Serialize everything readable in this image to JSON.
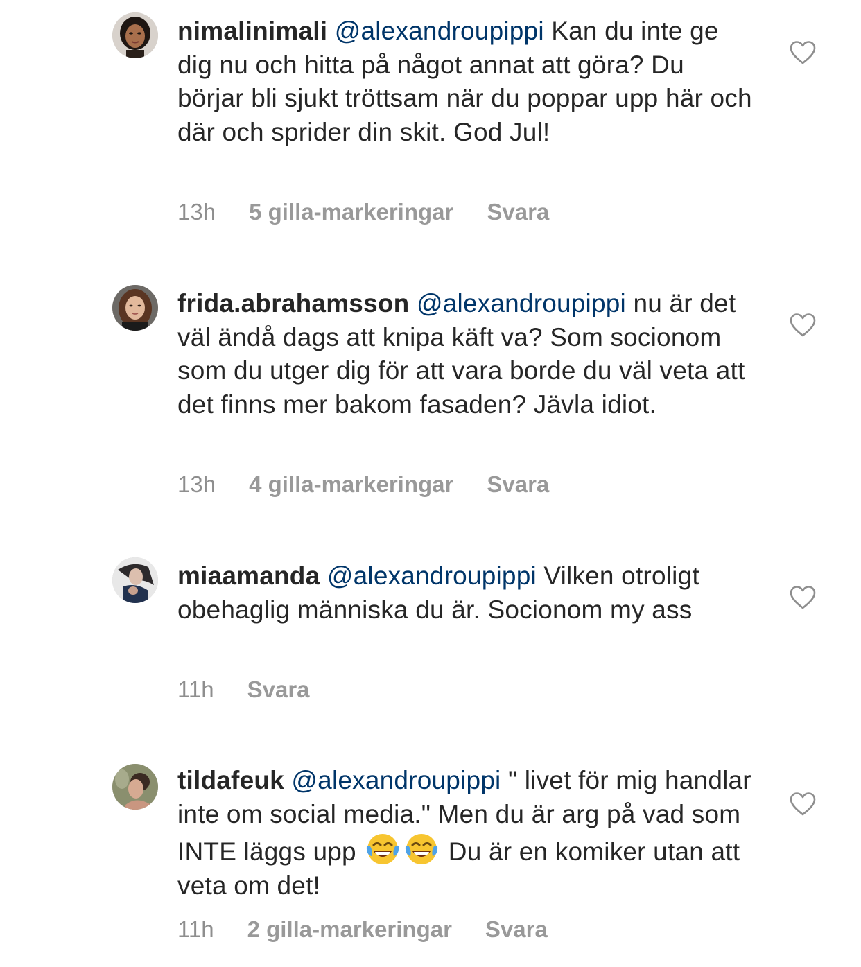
{
  "comments": [
    {
      "username": "nimalinimali",
      "mention": "@alexandroupippi",
      "text": "Kan du inte ge dig nu och hitta på något annat att göra? Du börjar bli sjukt tröttsam när du poppar upp här och där och sprider din skit. God Jul!",
      "time": "13h",
      "likes": "5 gilla-markeringar",
      "reply": "Svara",
      "avatar_icon": "avatar-icon"
    },
    {
      "username": "frida.abrahamsson",
      "mention": "@alexandroupippi",
      "text": "nu är det väl ändå dags att knipa käft va? Som socionom som du utger dig för att vara borde du väl veta att det finns mer bakom fasaden? Jävla idiot.",
      "time": "13h",
      "likes": "4 gilla-markeringar",
      "reply": "Svara",
      "avatar_icon": "avatar-icon"
    },
    {
      "username": "miaamanda",
      "mention": "@alexandroupippi",
      "text": "Vilken otroligt obehaglig människa du är. Socionom my ass",
      "time": "11h",
      "reply": "Svara",
      "avatar_icon": "avatar-icon"
    },
    {
      "username": "tildafeuk",
      "mention": "@alexandroupippi",
      "text_before_emoji": "\" livet för mig handlar inte om social media.\" Men du är arg på vad som INTE läggs upp",
      "text_after_emoji": "Du är en komiker utan att veta om det!",
      "emoji_icon": "face-with-tears-of-joy-icon",
      "time": "11h",
      "likes": "2 gilla-markeringar",
      "reply": "Svara",
      "avatar_icon": "avatar-icon"
    }
  ],
  "icons": {
    "like": "heart-outline-icon"
  },
  "colors": {
    "text": "#262626",
    "mention": "#003569",
    "meta": "#8e8e8e",
    "background": "#ffffff"
  }
}
